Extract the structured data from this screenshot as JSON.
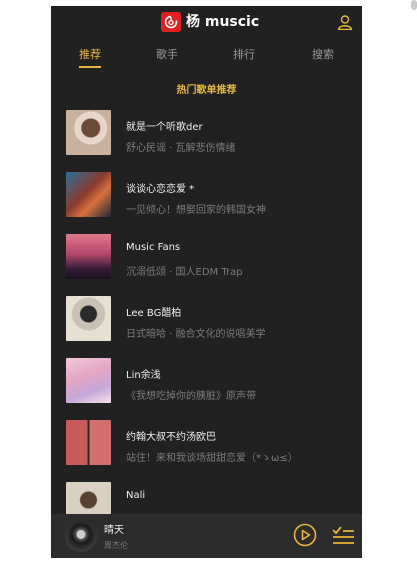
{
  "header": {
    "brand": "杨 muscic",
    "logo_icon": "music-logo-icon",
    "user_icon": "user-icon"
  },
  "tabs": [
    {
      "label": "推荐",
      "active": true
    },
    {
      "label": "歌手",
      "active": false
    },
    {
      "label": "排行",
      "active": false
    },
    {
      "label": "搜索",
      "active": false
    }
  ],
  "section_title": "热门歌单推荐",
  "playlists": [
    {
      "title": "就是一个听歌der",
      "subtitle": "舒心民谣 · 瓦解悲伤情绪"
    },
    {
      "title": "谈谈心恋恋爱 *",
      "subtitle": "一见倾心！想娶回家的韩国女神"
    },
    {
      "title": "Music Fans",
      "subtitle": "沉溺低颂 · 国人EDM Trap"
    },
    {
      "title": "Lee BG醋柏",
      "subtitle": "日式暗哈 · 融合文化的说唱美学"
    },
    {
      "title": "Lin余浅",
      "subtitle": "《我想吃掉你的胰脏》原声带"
    },
    {
      "title": "约翰大叔不约汤欧巴",
      "subtitle": "站住！来和我谈场甜甜恋爱（*ゝω≤）"
    },
    {
      "title": "Nali",
      "subtitle": ""
    }
  ],
  "player": {
    "song": "晴天",
    "artist": "周杰伦",
    "play_icon": "play-icon",
    "list_icon": "playlist-icon"
  },
  "colors": {
    "accent": "#e8b63a",
    "background": "#212121",
    "logo": "#e02020"
  }
}
